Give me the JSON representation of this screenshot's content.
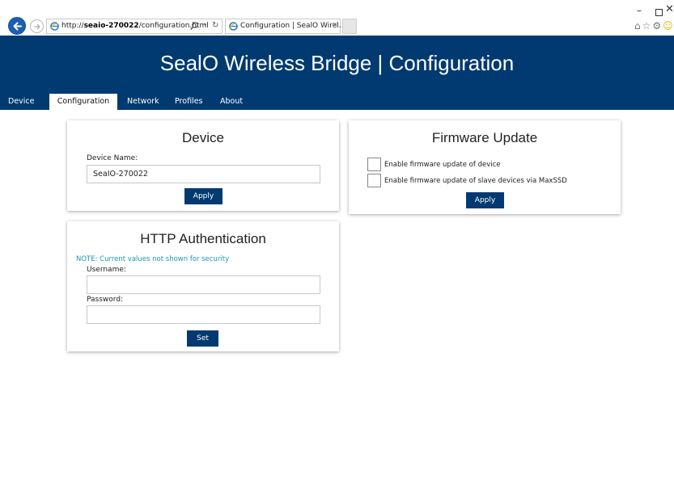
{
  "browser": {
    "url_prefix": "http://",
    "url_host": "seaio-270022",
    "url_path": "/configuration.html",
    "tab_label": "Configuration | SealO Wirel...",
    "tab_close": "×",
    "min_glyph": "–",
    "close_glyph": "✕",
    "toolbar_icons": [
      "home-icon",
      "star-icon",
      "gear-icon",
      "smiley-icon"
    ]
  },
  "header": {
    "title": "SealO Wireless Bridge | Configuration",
    "bg_color": "#003a70"
  },
  "nav": {
    "items": [
      {
        "label": "Device",
        "active": false
      },
      {
        "label": "Configuration",
        "active": true
      },
      {
        "label": "Network",
        "active": false
      },
      {
        "label": "Profiles",
        "active": false
      },
      {
        "label": "About",
        "active": false
      }
    ]
  },
  "device_card": {
    "title": "Device",
    "name_label": "Device Name:",
    "name_value": "SeaIO-270022",
    "apply_label": "Apply"
  },
  "firmware_card": {
    "title": "Firmware Update",
    "options": [
      {
        "label": "Enable firmware update of device",
        "checked": false
      },
      {
        "label": "Enable firmware update of slave devices via MaxSSD",
        "checked": false
      }
    ],
    "apply_label": "Apply"
  },
  "auth_card": {
    "title": "HTTP Authentication",
    "note": "NOTE: Current values not shown for security",
    "username_label": "Username:",
    "username_value": "",
    "password_label": "Password:",
    "password_value": "",
    "set_label": "Set"
  },
  "colors": {
    "accent": "#003a70",
    "note": "#1b9aa8"
  }
}
